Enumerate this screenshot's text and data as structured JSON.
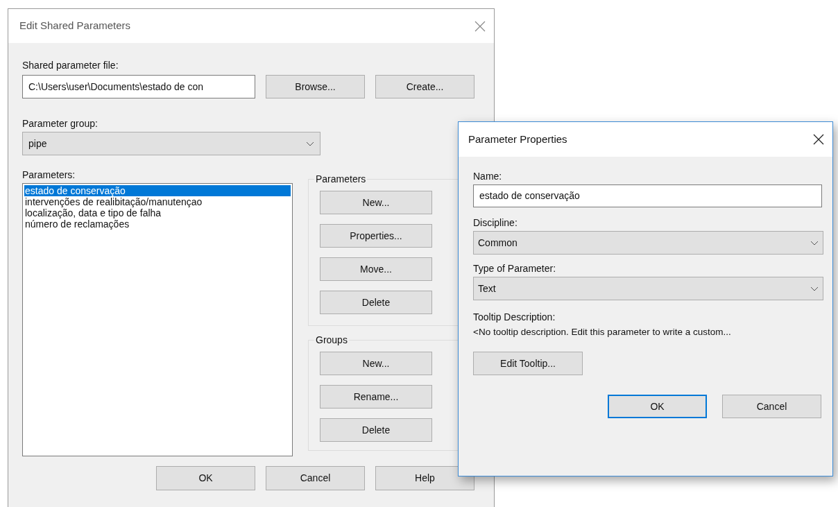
{
  "edit_dialog": {
    "title": "Edit Shared Parameters",
    "file_label": "Shared parameter file:",
    "file_path": "C:\\Users\\user\\Documents\\estado de con",
    "file_buttons": [
      "Browse...",
      "Create..."
    ],
    "group_label": "Parameter group:",
    "group_value": "pipe",
    "parameters_label": "Parameters:",
    "parameters": [
      {
        "label": "estado de conservação",
        "selected": true
      },
      {
        "label": "intervenções de realibitação/manutençao",
        "selected": false
      },
      {
        "label": "localização, data e tipo de falha",
        "selected": false
      },
      {
        "label": "número de reclamações",
        "selected": false
      }
    ],
    "parameter_box": {
      "title": "Parameters",
      "buttons": [
        "New...",
        "Properties...",
        "Move...",
        "Delete"
      ]
    },
    "groups_box": {
      "title": "Groups",
      "buttons": [
        "New...",
        "Rename...",
        "Delete"
      ]
    },
    "footer_buttons": [
      "OK",
      "Cancel",
      "Help"
    ]
  },
  "properties_dialog": {
    "title": "Parameter Properties",
    "name_label": "Name:",
    "name_value": "estado de conservação",
    "discipline_label": "Discipline:",
    "discipline_value": "Common",
    "type_label": "Type of Parameter:",
    "type_value": "Text",
    "tooltip_label": "Tooltip Description:",
    "tooltip_text": "<No tooltip description. Edit this parameter to write a custom...",
    "edit_tooltip_button": "Edit Tooltip...",
    "footer_buttons": [
      {
        "label": "OK",
        "default": true
      },
      {
        "label": "Cancel",
        "default": false
      }
    ]
  }
}
